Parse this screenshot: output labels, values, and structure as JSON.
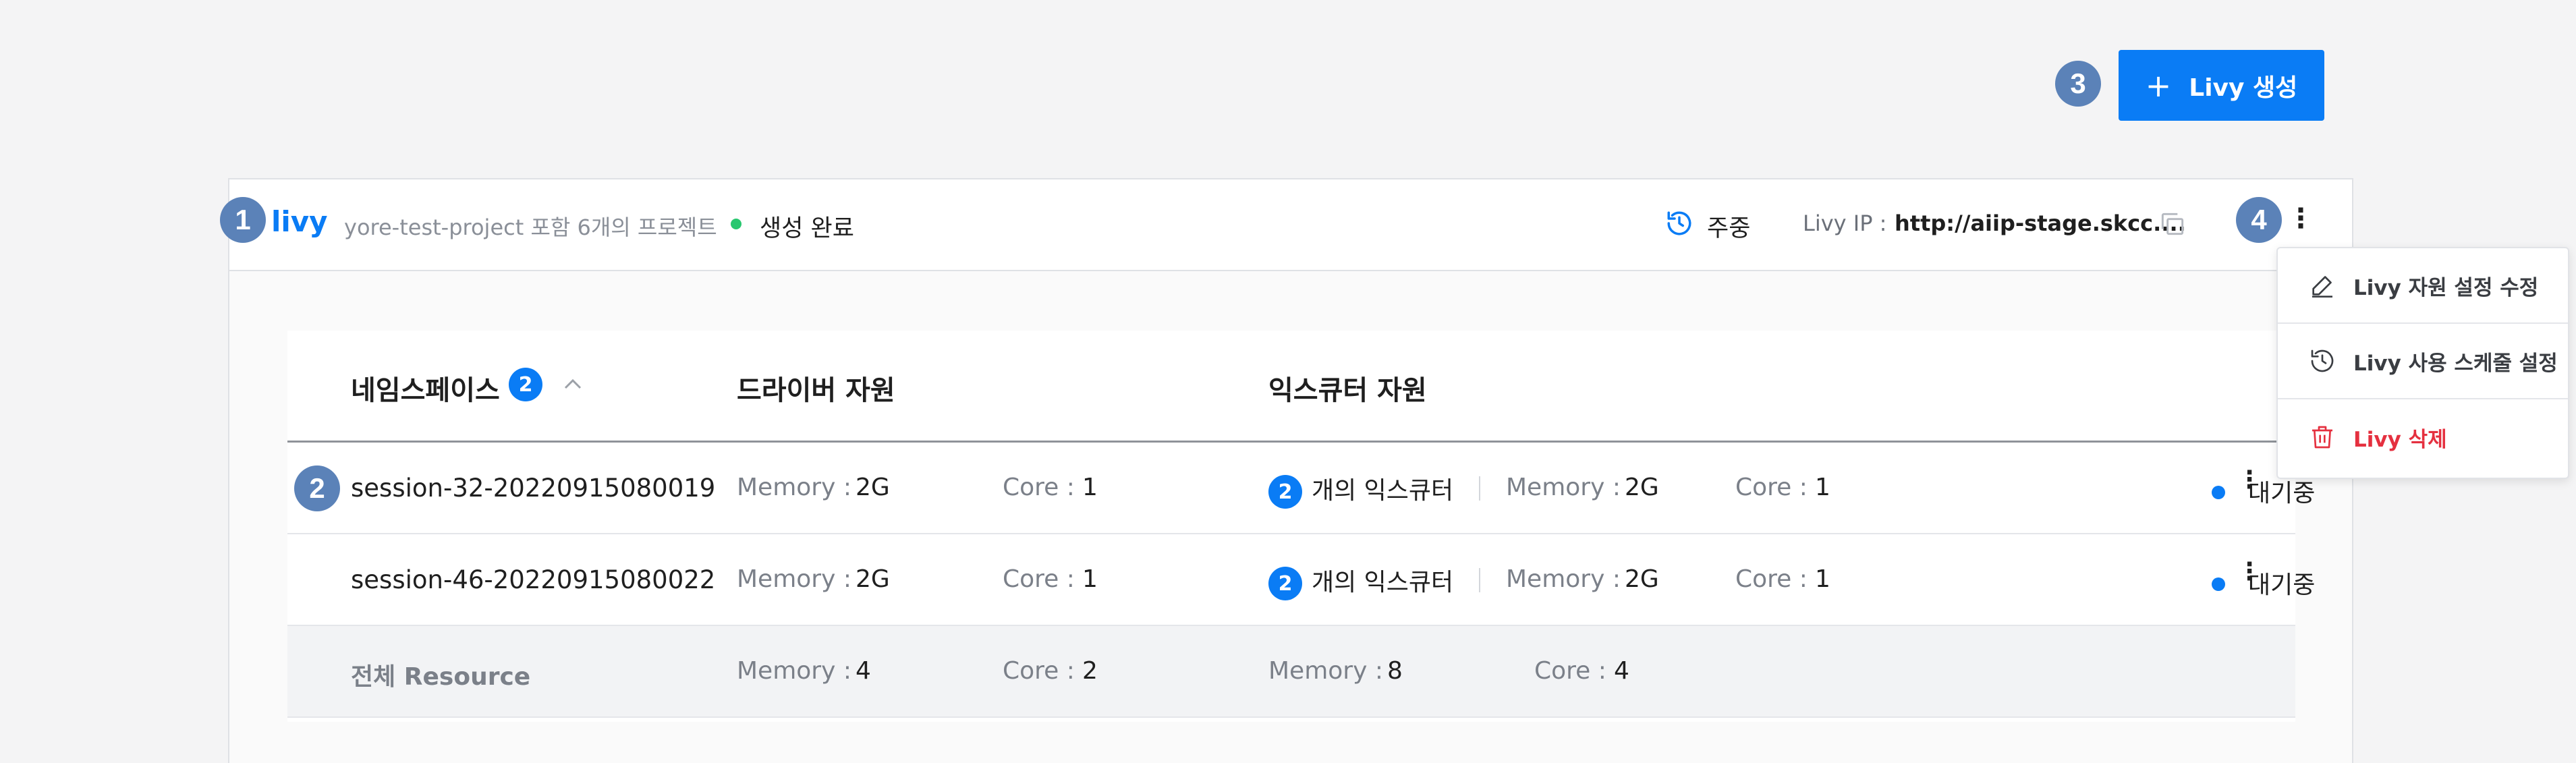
{
  "create_button": {
    "label": "Livy 생성",
    "plus": "+"
  },
  "callouts": [
    "1",
    "2",
    "3",
    "4"
  ],
  "livy": {
    "name": "livy",
    "projects": "yore-test-project 포함 6개의 프로젝트",
    "status": "생성 완료",
    "schedule": "주중",
    "ip_label": "Livy IP :",
    "ip_value": "http://aiip-stage.skcc....",
    "more": "⋮"
  },
  "table": {
    "headers": {
      "namespace": "네임스페이스",
      "namespace_count": "2",
      "driver": "드라이버 자원",
      "executor": "익스큐터 자원"
    },
    "rows": [
      {
        "session": "session-32-20220915080019",
        "driver_memory_label": "Memory :",
        "driver_memory": "2G",
        "driver_core_label": "Core :",
        "driver_core": "1",
        "executor_count": "2",
        "executor_count_label": "개의 익스큐터",
        "exec_memory_label": "Memory :",
        "exec_memory": "2G",
        "exec_core_label": "Core :",
        "exec_core": "1",
        "status": "대기중",
        "more": "⋮"
      },
      {
        "session": "session-46-20220915080022",
        "driver_memory_label": "Memory :",
        "driver_memory": "2G",
        "driver_core_label": "Core :",
        "driver_core": "1",
        "executor_count": "2",
        "executor_count_label": "개의 익스큐터",
        "exec_memory_label": "Memory :",
        "exec_memory": "2G",
        "exec_core_label": "Core :",
        "exec_core": "1",
        "status": "대기중",
        "more": "⋮"
      }
    ],
    "total": {
      "label": "전체 Resource",
      "driver_memory_label": "Memory :",
      "driver_memory": "4",
      "driver_core_label": "Core :",
      "driver_core": "2",
      "exec_memory_label": "Memory :",
      "exec_memory": "8",
      "exec_core_label": "Core :",
      "exec_core": "4"
    }
  },
  "menu": {
    "items": [
      {
        "label": "Livy 자원 설정 수정",
        "icon": "edit-icon"
      },
      {
        "label": "Livy 사용 스케줄 설정",
        "icon": "history-icon"
      },
      {
        "label": "Livy 삭제",
        "icon": "trash-icon"
      }
    ]
  },
  "colors": {
    "accent": "#0a7cf5",
    "callout": "#5b82b8",
    "status_done": "#28c76f",
    "danger": "#e5303f"
  }
}
